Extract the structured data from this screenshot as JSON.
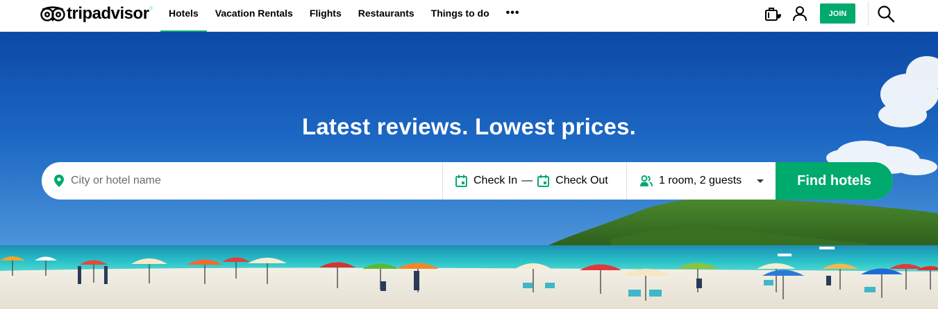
{
  "brand": {
    "name": "tripadvisor",
    "registered": "®",
    "accent_color": "#00aa6c",
    "logo_icon": "owl-eyes-logo"
  },
  "nav": {
    "items": [
      {
        "label": "Hotels",
        "active": true
      },
      {
        "label": "Vacation Rentals",
        "active": false
      },
      {
        "label": "Flights",
        "active": false
      },
      {
        "label": "Restaurants",
        "active": false
      },
      {
        "label": "Things to do",
        "active": false
      }
    ],
    "more_label": "•••"
  },
  "header_actions": {
    "trips_icon": "suitcase-heart-icon",
    "profile_icon": "user-icon",
    "join_label": "JOIN",
    "search_icon": "search-icon"
  },
  "hero": {
    "title": "Latest reviews. Lowest prices."
  },
  "search": {
    "destination_placeholder": "City or hotel name",
    "destination_value": "",
    "check_in_label": "Check In",
    "dash": "—",
    "check_out_label": "Check Out",
    "guests_label": "1 room, 2 guests",
    "submit_label": "Find hotels"
  }
}
